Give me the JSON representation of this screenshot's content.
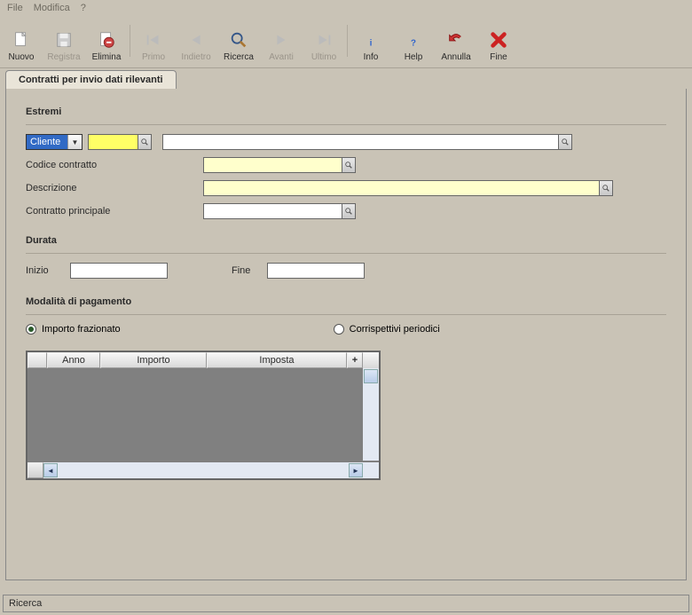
{
  "menu": {
    "file": "File",
    "edit": "Modifica",
    "help": "?"
  },
  "toolbar": {
    "nuovo": "Nuovo",
    "registra": "Registra",
    "elimina": "Elimina",
    "primo": "Primo",
    "indietro": "Indietro",
    "ricerca": "Ricerca",
    "avanti": "Avanti",
    "ultimo": "Ultimo",
    "info": "Info",
    "help_btn": "Help",
    "annulla": "Annulla",
    "fine": "Fine"
  },
  "tab": {
    "title": "Contratti per invio dati rilevanti"
  },
  "sections": {
    "estremi": "Estremi",
    "durata": "Durata",
    "pagamento": "Modalità di pagamento"
  },
  "fields": {
    "cliente_label": "Cliente",
    "cliente_value": "",
    "codice_contratto_label": "Codice contratto",
    "descrizione_label": "Descrizione",
    "contratto_principale_label": "Contratto principale",
    "inizio_label": "Inizio",
    "fine_label": "Fine"
  },
  "payment": {
    "opt1": "Importo frazionato",
    "opt2": "Corrispettivi periodici",
    "selected": "opt1"
  },
  "grid": {
    "col_anno": "Anno",
    "col_importo": "Importo",
    "col_imposta": "Imposta",
    "plus": "+"
  },
  "status": {
    "text": "Ricerca",
    "brand": ""
  }
}
